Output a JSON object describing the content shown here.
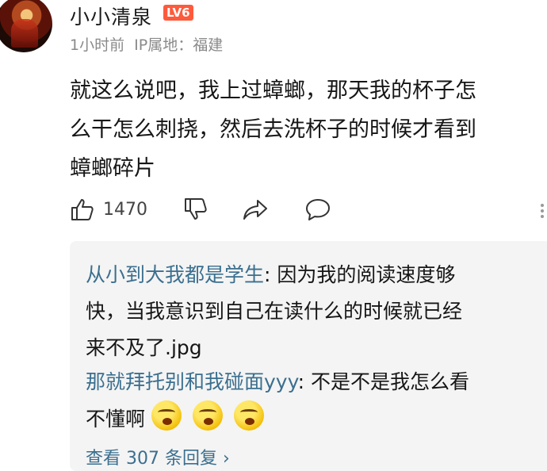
{
  "comment": {
    "username": "小小清泉",
    "level_badge": "LV6",
    "time": "1小时前",
    "ip_label": "IP属地：福建",
    "text": "就这么说吧，我上过蟑螂，那天我的杯子怎\n么干怎么刺挠，然后去洗杯子的时候才看到\n蟑螂碎片",
    "like_count": "1470"
  },
  "replies": [
    {
      "name": "从小到大我都是学生",
      "text": ": 因为我的阅读速度够\n快，当我意识到自己在读什么的时候就已经\n来不及了.jpg"
    },
    {
      "name": "那就拜托别和我碰面yyy",
      "text": ": 不是不是我怎么看\n不懂啊",
      "emoji_count": 3,
      "emoji_name": "facepalm-emoji"
    }
  ],
  "view_replies": "查看 307 条回复 ›",
  "colors": {
    "reply_name": "#3b6f8f",
    "badge": "#ff5a3c",
    "meta": "#8a8a8a",
    "reply_bg": "#f4f4f4"
  }
}
